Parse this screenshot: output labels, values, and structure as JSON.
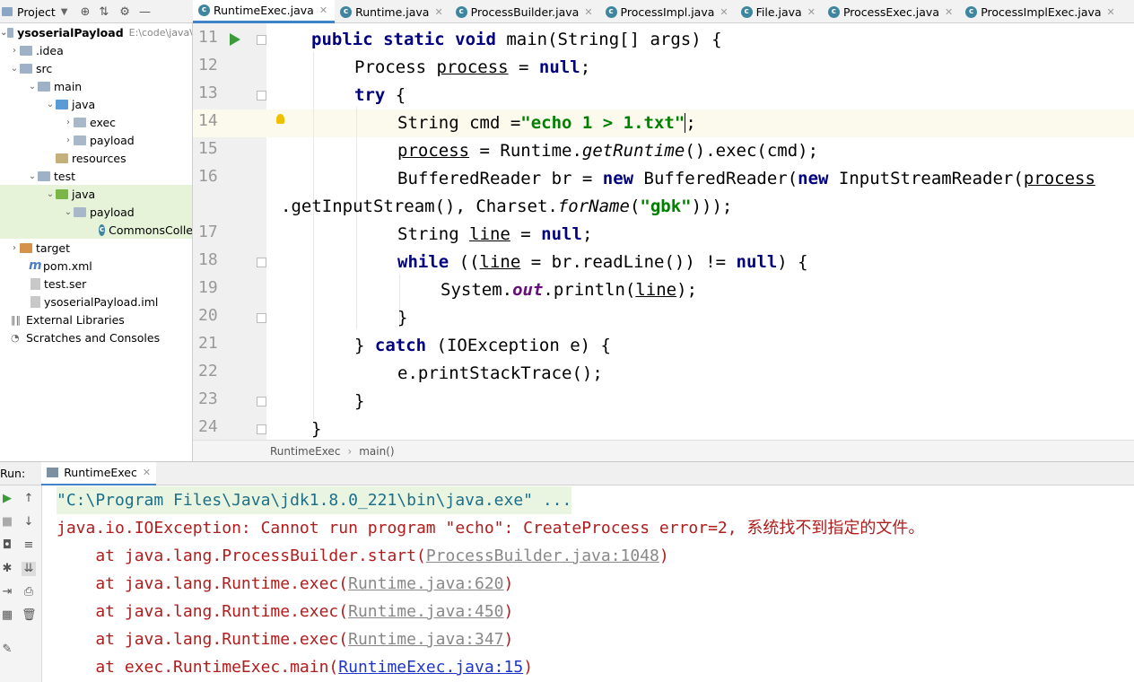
{
  "project_header": {
    "label": "Project",
    "dropdown_icon": "chevron-down-icon"
  },
  "tabs": [
    {
      "label": "RuntimeExec.java",
      "active": true
    },
    {
      "label": "Runtime.java"
    },
    {
      "label": "ProcessBuilder.java"
    },
    {
      "label": "ProcessImpl.java"
    },
    {
      "label": "File.java"
    },
    {
      "label": "ProcessExec.java"
    },
    {
      "label": "ProcessImplExec.java"
    }
  ],
  "tree": {
    "root": "ysoserialPayload",
    "root_path": "E:\\code\\java\\",
    "idea": ".idea",
    "src": "src",
    "main": "main",
    "java1": "java",
    "exec": "exec",
    "payload1": "payload",
    "resources": "resources",
    "test": "test",
    "java2": "java",
    "payload2": "payload",
    "commons": "CommonsColle",
    "target": "target",
    "pom": "pom.xml",
    "ser": "test.ser",
    "iml": "ysoserialPayload.iml",
    "libs": "External Libraries",
    "scratches": "Scratches and Consoles"
  },
  "editor": {
    "line_numbers": [
      "11",
      "12",
      "13",
      "14",
      "",
      "15",
      "16",
      "",
      "17",
      "18",
      "19",
      "20",
      "21",
      "22",
      "23",
      "24"
    ],
    "highlight_color": "#fcfaed"
  },
  "code": {
    "l11a": "public static void ",
    "l11b": "main(String[] args) {",
    "l12a": "Process ",
    "l12b": "process",
    "l12c": " = ",
    "l12d": "null",
    ";": ";",
    "l13a": "try",
    " {": " {",
    "l14a": "String cmd =",
    "l14b": "\"echo 1 > 1.txt\"",
    "l14c": ";",
    "l15a": "process",
    "l15b": " = Runtime.",
    "l15c": "getRuntime",
    "l15d": "().exec(cmd);",
    "l16a": "BufferedReader br = ",
    "l16b": "new",
    " BufferedReader(": " BufferedReader(",
    "l16c": "new",
    "l16d": " InputStreamReader(",
    "l16e": "process",
    "l16w1": ".getInputStream(), Charset.",
    "l16w2": "forName",
    "l16w3": "(",
    "l16w4": "\"gbk\"",
    "l16w5": ")));",
    "l17a": "String ",
    "l17b": "line",
    "l17c": " = ",
    "l17d": "null",
    "l17e": ";",
    "l18a": "while",
    " ((": " ((",
    "l18b": "line",
    "l18c": " = br.readLine()) != ",
    "l18d": "null",
    "l18e": ") {",
    "l19a": "System.",
    "l19b": "out",
    "l19c": ".println(",
    "l19d": "line",
    "l19e": ");",
    "l20": "}",
    "l21a": "} ",
    "l21b": "catch",
    "l21c": " (IOException e) {",
    "l22": "e.printStackTrace();",
    "l23": "}",
    "l24": "}"
  },
  "breadcrumbs": {
    "item1": "RuntimeExec",
    "item2": "main()"
  },
  "run": {
    "label": "Run:",
    "tab": "RuntimeExec"
  },
  "console": {
    "cmd": "\"C:\\Program Files\\Java\\jdk1.8.0_221\\bin\\java.exe\" ...",
    "error": "java.io.IOException: Cannot run program \"echo\": CreateProcess error=2, 系统找不到指定的文件。",
    "t1a": "    at java.lang.ProcessBuilder.start(",
    "t1b": "ProcessBuilder.java:1048",
    "t1c": ")",
    "t2a": "    at java.lang.Runtime.exec(",
    "t2b": "Runtime.java:620",
    "t2c": ")",
    "t3a": "    at java.lang.Runtime.exec(",
    "t3b": "Runtime.java:450",
    "t3c": ")",
    "t4a": "    at java.lang.Runtime.exec(",
    "t4b": "Runtime.java:347",
    "t4c": ")",
    "t5a": "    at exec.RuntimeExec.main(",
    "t5b": "RuntimeExec.java:15",
    "t5c": ")"
  }
}
